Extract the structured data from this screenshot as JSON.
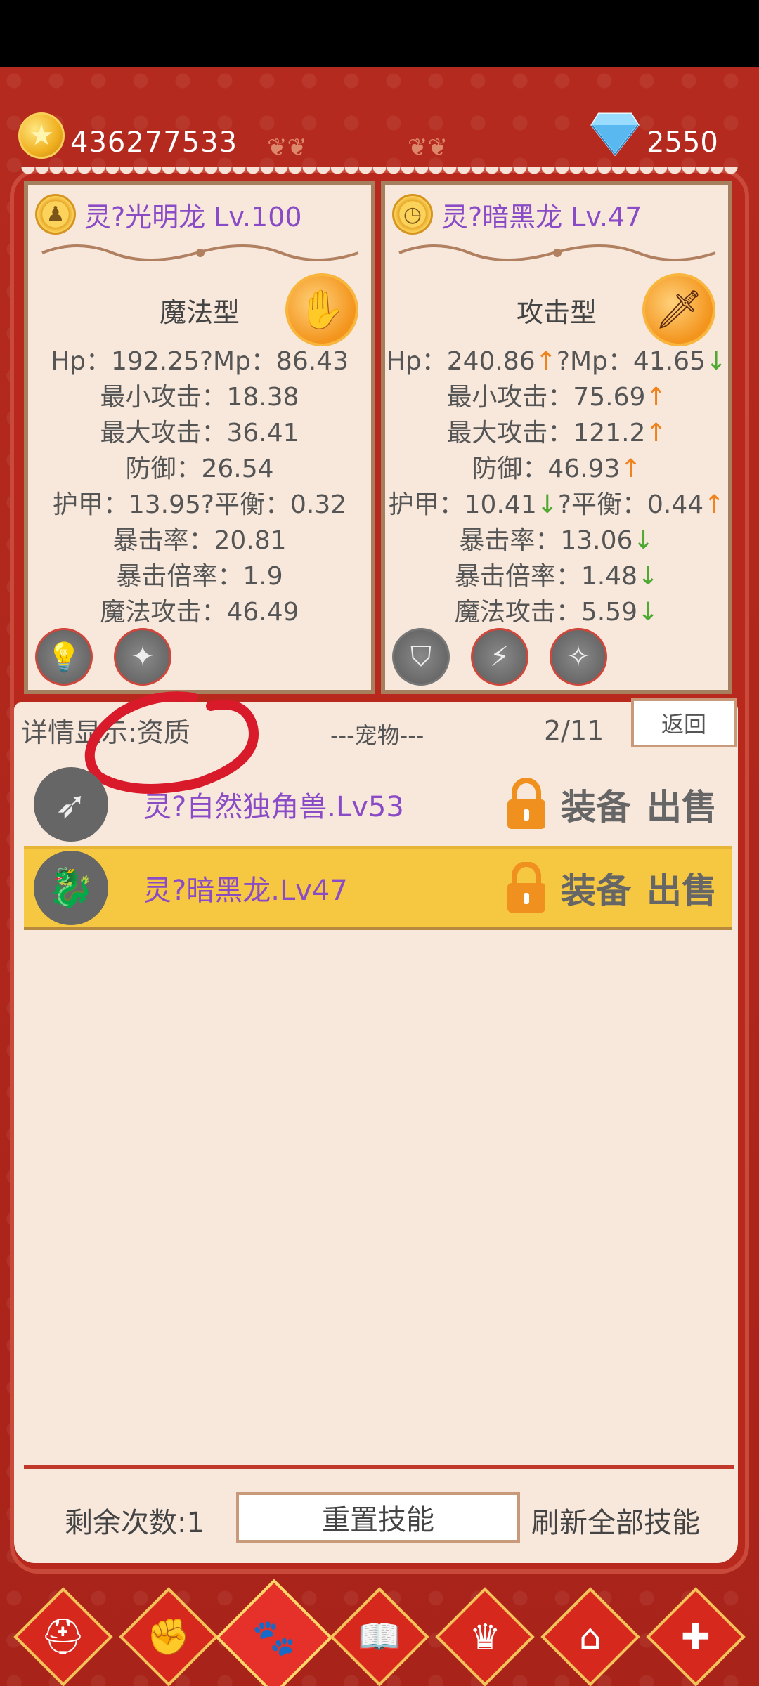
{
  "header": {
    "gold": "436277533",
    "gems": "2550",
    "gold_icon": "star-coin-icon",
    "gem_icon": "diamond-icon"
  },
  "left_pet": {
    "title": "灵?光明龙 Lv.100",
    "type": "魔法型",
    "stats": [
      "Hp：192.25?Mp：86.43",
      "最小攻击：18.38",
      "最大攻击：36.41",
      "防御：26.54",
      "护甲：13.95?平衡：0.32",
      "暴击率：20.81",
      "暴击倍率：1.9",
      "魔法攻击：46.49"
    ]
  },
  "right_pet": {
    "title": "灵?暗黑龙 Lv.47",
    "type": "攻击型",
    "stats": [
      {
        "text": "Hp：240.86",
        "arrow": "↑",
        "dir": "up",
        "text2": "?Mp：41.65",
        "arrow2": "↓",
        "dir2": "down"
      },
      {
        "text": "最小攻击：75.69",
        "arrow": "↑",
        "dir": "up"
      },
      {
        "text": "最大攻击：121.2",
        "arrow": "↑",
        "dir": "up"
      },
      {
        "text": "防御：46.93",
        "arrow": "↑",
        "dir": "up"
      },
      {
        "text": "护甲：10.41",
        "arrow": "↓",
        "dir": "down",
        "text2": "?平衡：0.44",
        "arrow2": "↑",
        "dir2": "up"
      },
      {
        "text": "暴击率：13.06",
        "arrow": "↓",
        "dir": "down"
      },
      {
        "text": "暴击倍率：1.48",
        "arrow": "↓",
        "dir": "down"
      },
      {
        "text": "魔法攻击：5.59",
        "arrow": "↓",
        "dir": "down"
      }
    ]
  },
  "list": {
    "detail_label": "详情显示:资质",
    "section_title": "---宠物---",
    "page": "2/11",
    "back_label": "返回",
    "rows": [
      {
        "name": "灵?自然独角兽.Lv53",
        "equip": "装备",
        "sell": "出售"
      },
      {
        "name": "灵?暗黑龙.Lv47",
        "equip": "装备",
        "sell": "出售"
      }
    ]
  },
  "footer": {
    "remaining": "剩余次数:1",
    "reset_label": "重置技能",
    "refresh_label": "刷新全部技能"
  },
  "nav_icons": [
    "knight-helmet-icon",
    "fist-icon",
    "paw-icon",
    "book-icon",
    "crown-icon",
    "money-house-icon",
    "plus-icon"
  ]
}
